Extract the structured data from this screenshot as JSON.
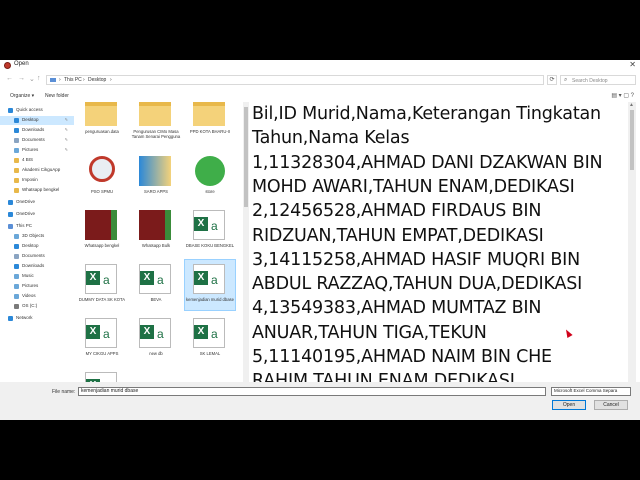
{
  "window": {
    "title": "Open"
  },
  "address": {
    "crumbs": [
      "This PC",
      "Desktop"
    ],
    "search_placeholder": "Search Desktop"
  },
  "toolbar": {
    "organize": "Organize ▾",
    "new_folder": "New folder"
  },
  "nav": [
    {
      "label": "Quick access",
      "icon": "star-icon",
      "color": "#2b88d8"
    },
    {
      "label": "Desktop",
      "icon": "desktop-icon",
      "color": "#2b88d8"
    },
    {
      "label": "Downloads",
      "icon": "download-icon",
      "color": "#2b88d8"
    },
    {
      "label": "Documents",
      "icon": "document-icon",
      "color": "#8aa4c2"
    },
    {
      "label": "Pictures",
      "icon": "picture-icon",
      "color": "#6aa7d8"
    },
    {
      "label": "4 BIS",
      "icon": "folder-icon",
      "color": "#e8b84a"
    },
    {
      "label": "Akademi CikguApp",
      "icon": "folder-icon",
      "color": "#e8b84a"
    },
    {
      "label": "Imposin",
      "icon": "folder-icon",
      "color": "#e8b84a"
    },
    {
      "label": "Whatsapp bengkel",
      "icon": "folder-icon",
      "color": "#e8b84a"
    },
    {
      "label": "OneDrive",
      "icon": "cloud-icon",
      "color": "#2b88d8"
    },
    {
      "label": "OneDrive",
      "icon": "cloud-icon",
      "color": "#2b88d8"
    },
    {
      "label": "This PC",
      "icon": "computer-icon",
      "color": "#5b8fd6"
    },
    {
      "label": "3D Objects",
      "icon": "cube-icon",
      "color": "#6aa7d8"
    },
    {
      "label": "Desktop",
      "icon": "desktop-icon",
      "color": "#2b88d8"
    },
    {
      "label": "Documents",
      "icon": "document-icon",
      "color": "#8aa4c2"
    },
    {
      "label": "Downloads",
      "icon": "download-icon",
      "color": "#2b88d8"
    },
    {
      "label": "Music",
      "icon": "music-icon",
      "color": "#6aa7d8"
    },
    {
      "label": "Pictures",
      "icon": "picture-icon",
      "color": "#6aa7d8"
    },
    {
      "label": "Videos",
      "icon": "video-icon",
      "color": "#6aa7d8"
    },
    {
      "label": "OS (C:)",
      "icon": "drive-icon",
      "color": "#7a7a7a"
    },
    {
      "label": "Network",
      "icon": "network-icon",
      "color": "#2b88d8"
    }
  ],
  "files": [
    {
      "caption": "penguruasan.data",
      "kind": "folder"
    },
    {
      "caption": "Pengurusan CIMo Masa Tanam Senarai Pengguna",
      "kind": "folder"
    },
    {
      "caption": "PPD KOTA BHARU-II",
      "kind": "folder"
    },
    {
      "caption": "PSO SPMU",
      "kind": "app-pso"
    },
    {
      "caption": "SARO APPS",
      "kind": "app-saro"
    },
    {
      "caption": "store",
      "kind": "app-store"
    },
    {
      "caption": "Whatsapp bengkel",
      "kind": "app-box"
    },
    {
      "caption": "Whatsapp Bulk",
      "kind": "app-box"
    },
    {
      "caption": "DBASE KOKU BENGKEL",
      "kind": "excel"
    },
    {
      "caption": "DUMMY DATA SK KOTA",
      "kind": "excel"
    },
    {
      "caption": "BEVA",
      "kind": "excel"
    },
    {
      "caption": "kemenjadian murid dbase",
      "kind": "excel",
      "selected": true
    },
    {
      "caption": "MY CIKGU APPS",
      "kind": "excel"
    },
    {
      "caption": "new db",
      "kind": "excel"
    },
    {
      "caption": "SK LEMAL",
      "kind": "excel"
    },
    {
      "caption": "",
      "kind": "excel"
    }
  ],
  "preview": {
    "lines": [
      "Bil,ID Murid,Nama,Keterangan Tingkatan",
      "Tahun,Nama Kelas",
      "1,11328304,AHMAD DANI DZAKWAN BIN",
      "MOHD AWARI,TAHUN ENAM,DEDIKASI",
      "2,12456528,AHMAD FIRDAUS BIN",
      "RIDZUAN,TAHUN EMPAT,DEDIKASI",
      "3,14115258,AHMAD HASIF MUQRI BIN",
      "ABDUL RAZZAQ,TAHUN DUA,DEDIKASI",
      "4,13549383,AHMAD MUMTAZ BIN",
      "ANUAR,TAHUN TIGA,TEKUN",
      "5,11140195,AHMAD NAIM BIN CHE",
      "RAHIM,TAHUN ENAM,DEDIKASI"
    ]
  },
  "footer": {
    "file_name_label": "File name:",
    "file_name_value": "kemenjadian murid dbase",
    "file_type": "Microsoft Excel Comma Separa",
    "open": "Open",
    "cancel": "Cancel"
  }
}
